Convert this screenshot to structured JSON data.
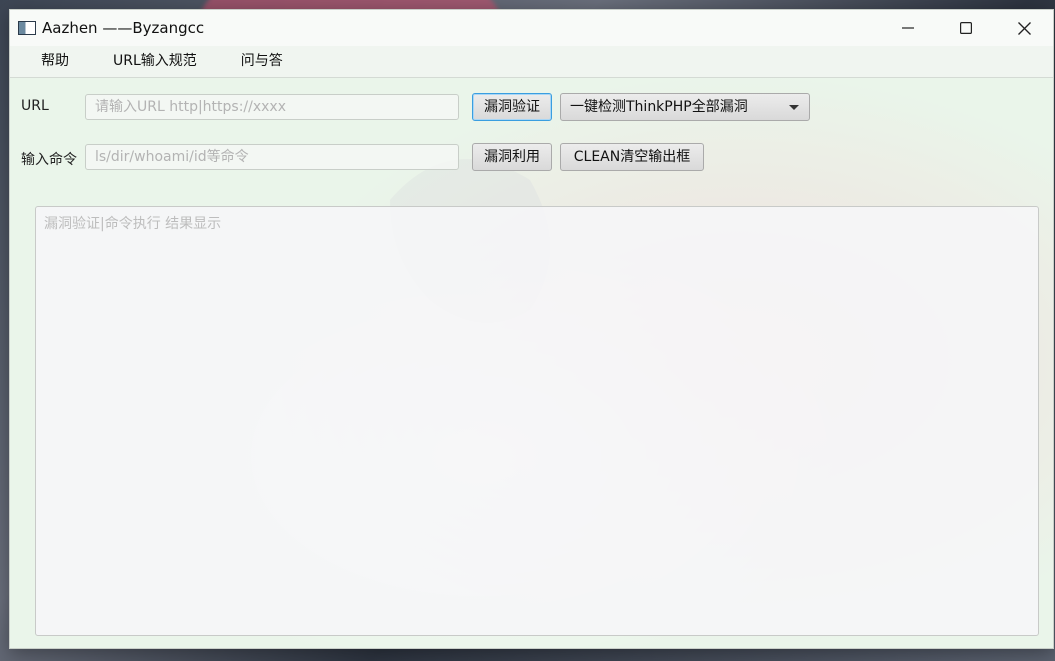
{
  "window": {
    "title": "Aazhen ——Byzangcc"
  },
  "menu": {
    "items": [
      "帮助",
      "URL输入规范",
      "问与答"
    ]
  },
  "form": {
    "url_label": "URL",
    "url_placeholder": "请输入URL http|https://xxxx",
    "verify_button": "漏洞验证",
    "scan_select_value": "一键检测ThinkPHP全部漏洞",
    "command_label": "输入命令",
    "command_placeholder": "ls/dir/whoami/id等命令",
    "exploit_button": "漏洞利用",
    "clean_button": "CLEAN清空输出框"
  },
  "output": {
    "placeholder": "漏洞验证|命令执行 结果显示"
  },
  "icons": {
    "app": "app-window-icon",
    "minimize": "minimize-icon",
    "maximize": "maximize-icon",
    "close": "close-icon",
    "dropdown": "chevron-down-icon"
  }
}
